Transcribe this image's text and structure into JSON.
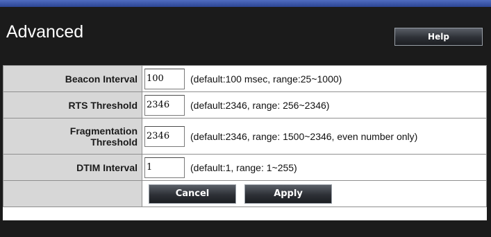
{
  "header": {
    "title": "Advanced",
    "help_label": "Help"
  },
  "rows": [
    {
      "label": "Beacon Interval",
      "value": "100",
      "hint": "(default:100 msec, range:25~1000)"
    },
    {
      "label": "RTS Threshold",
      "value": "2346",
      "hint": "(default:2346, range: 256~2346)"
    },
    {
      "label_line1": "Fragmentation",
      "label_line2": "Threshold",
      "value": "2346",
      "hint": "(default:2346, range: 1500~2346, even number only)"
    },
    {
      "label": "DTIM Interval",
      "value": "1",
      "hint": "(default:1, range: 1~255)"
    }
  ],
  "actions": {
    "cancel_label": "Cancel",
    "apply_label": "Apply"
  },
  "colors": {
    "background": "#1b1b1b",
    "top_band": "#3a56a8",
    "label_cell": "#d7d7d7",
    "button": "#2d3036"
  }
}
